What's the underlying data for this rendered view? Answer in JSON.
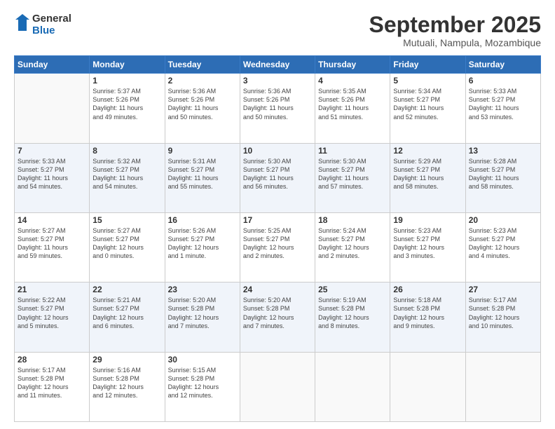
{
  "header": {
    "logo_text_general": "General",
    "logo_text_blue": "Blue",
    "month": "September 2025",
    "location": "Mutuali, Nampula, Mozambique"
  },
  "days_of_week": [
    "Sunday",
    "Monday",
    "Tuesday",
    "Wednesday",
    "Thursday",
    "Friday",
    "Saturday"
  ],
  "weeks": [
    [
      {
        "day": "",
        "info": ""
      },
      {
        "day": "1",
        "info": "Sunrise: 5:37 AM\nSunset: 5:26 PM\nDaylight: 11 hours\nand 49 minutes."
      },
      {
        "day": "2",
        "info": "Sunrise: 5:36 AM\nSunset: 5:26 PM\nDaylight: 11 hours\nand 50 minutes."
      },
      {
        "day": "3",
        "info": "Sunrise: 5:36 AM\nSunset: 5:26 PM\nDaylight: 11 hours\nand 50 minutes."
      },
      {
        "day": "4",
        "info": "Sunrise: 5:35 AM\nSunset: 5:26 PM\nDaylight: 11 hours\nand 51 minutes."
      },
      {
        "day": "5",
        "info": "Sunrise: 5:34 AM\nSunset: 5:27 PM\nDaylight: 11 hours\nand 52 minutes."
      },
      {
        "day": "6",
        "info": "Sunrise: 5:33 AM\nSunset: 5:27 PM\nDaylight: 11 hours\nand 53 minutes."
      }
    ],
    [
      {
        "day": "7",
        "info": "Sunrise: 5:33 AM\nSunset: 5:27 PM\nDaylight: 11 hours\nand 54 minutes."
      },
      {
        "day": "8",
        "info": "Sunrise: 5:32 AM\nSunset: 5:27 PM\nDaylight: 11 hours\nand 54 minutes."
      },
      {
        "day": "9",
        "info": "Sunrise: 5:31 AM\nSunset: 5:27 PM\nDaylight: 11 hours\nand 55 minutes."
      },
      {
        "day": "10",
        "info": "Sunrise: 5:30 AM\nSunset: 5:27 PM\nDaylight: 11 hours\nand 56 minutes."
      },
      {
        "day": "11",
        "info": "Sunrise: 5:30 AM\nSunset: 5:27 PM\nDaylight: 11 hours\nand 57 minutes."
      },
      {
        "day": "12",
        "info": "Sunrise: 5:29 AM\nSunset: 5:27 PM\nDaylight: 11 hours\nand 58 minutes."
      },
      {
        "day": "13",
        "info": "Sunrise: 5:28 AM\nSunset: 5:27 PM\nDaylight: 11 hours\nand 58 minutes."
      }
    ],
    [
      {
        "day": "14",
        "info": "Sunrise: 5:27 AM\nSunset: 5:27 PM\nDaylight: 11 hours\nand 59 minutes."
      },
      {
        "day": "15",
        "info": "Sunrise: 5:27 AM\nSunset: 5:27 PM\nDaylight: 12 hours\nand 0 minutes."
      },
      {
        "day": "16",
        "info": "Sunrise: 5:26 AM\nSunset: 5:27 PM\nDaylight: 12 hours\nand 1 minute."
      },
      {
        "day": "17",
        "info": "Sunrise: 5:25 AM\nSunset: 5:27 PM\nDaylight: 12 hours\nand 2 minutes."
      },
      {
        "day": "18",
        "info": "Sunrise: 5:24 AM\nSunset: 5:27 PM\nDaylight: 12 hours\nand 2 minutes."
      },
      {
        "day": "19",
        "info": "Sunrise: 5:23 AM\nSunset: 5:27 PM\nDaylight: 12 hours\nand 3 minutes."
      },
      {
        "day": "20",
        "info": "Sunrise: 5:23 AM\nSunset: 5:27 PM\nDaylight: 12 hours\nand 4 minutes."
      }
    ],
    [
      {
        "day": "21",
        "info": "Sunrise: 5:22 AM\nSunset: 5:27 PM\nDaylight: 12 hours\nand 5 minutes."
      },
      {
        "day": "22",
        "info": "Sunrise: 5:21 AM\nSunset: 5:27 PM\nDaylight: 12 hours\nand 6 minutes."
      },
      {
        "day": "23",
        "info": "Sunrise: 5:20 AM\nSunset: 5:28 PM\nDaylight: 12 hours\nand 7 minutes."
      },
      {
        "day": "24",
        "info": "Sunrise: 5:20 AM\nSunset: 5:28 PM\nDaylight: 12 hours\nand 7 minutes."
      },
      {
        "day": "25",
        "info": "Sunrise: 5:19 AM\nSunset: 5:28 PM\nDaylight: 12 hours\nand 8 minutes."
      },
      {
        "day": "26",
        "info": "Sunrise: 5:18 AM\nSunset: 5:28 PM\nDaylight: 12 hours\nand 9 minutes."
      },
      {
        "day": "27",
        "info": "Sunrise: 5:17 AM\nSunset: 5:28 PM\nDaylight: 12 hours\nand 10 minutes."
      }
    ],
    [
      {
        "day": "28",
        "info": "Sunrise: 5:17 AM\nSunset: 5:28 PM\nDaylight: 12 hours\nand 11 minutes."
      },
      {
        "day": "29",
        "info": "Sunrise: 5:16 AM\nSunset: 5:28 PM\nDaylight: 12 hours\nand 12 minutes."
      },
      {
        "day": "30",
        "info": "Sunrise: 5:15 AM\nSunset: 5:28 PM\nDaylight: 12 hours\nand 12 minutes."
      },
      {
        "day": "",
        "info": ""
      },
      {
        "day": "",
        "info": ""
      },
      {
        "day": "",
        "info": ""
      },
      {
        "day": "",
        "info": ""
      }
    ]
  ]
}
